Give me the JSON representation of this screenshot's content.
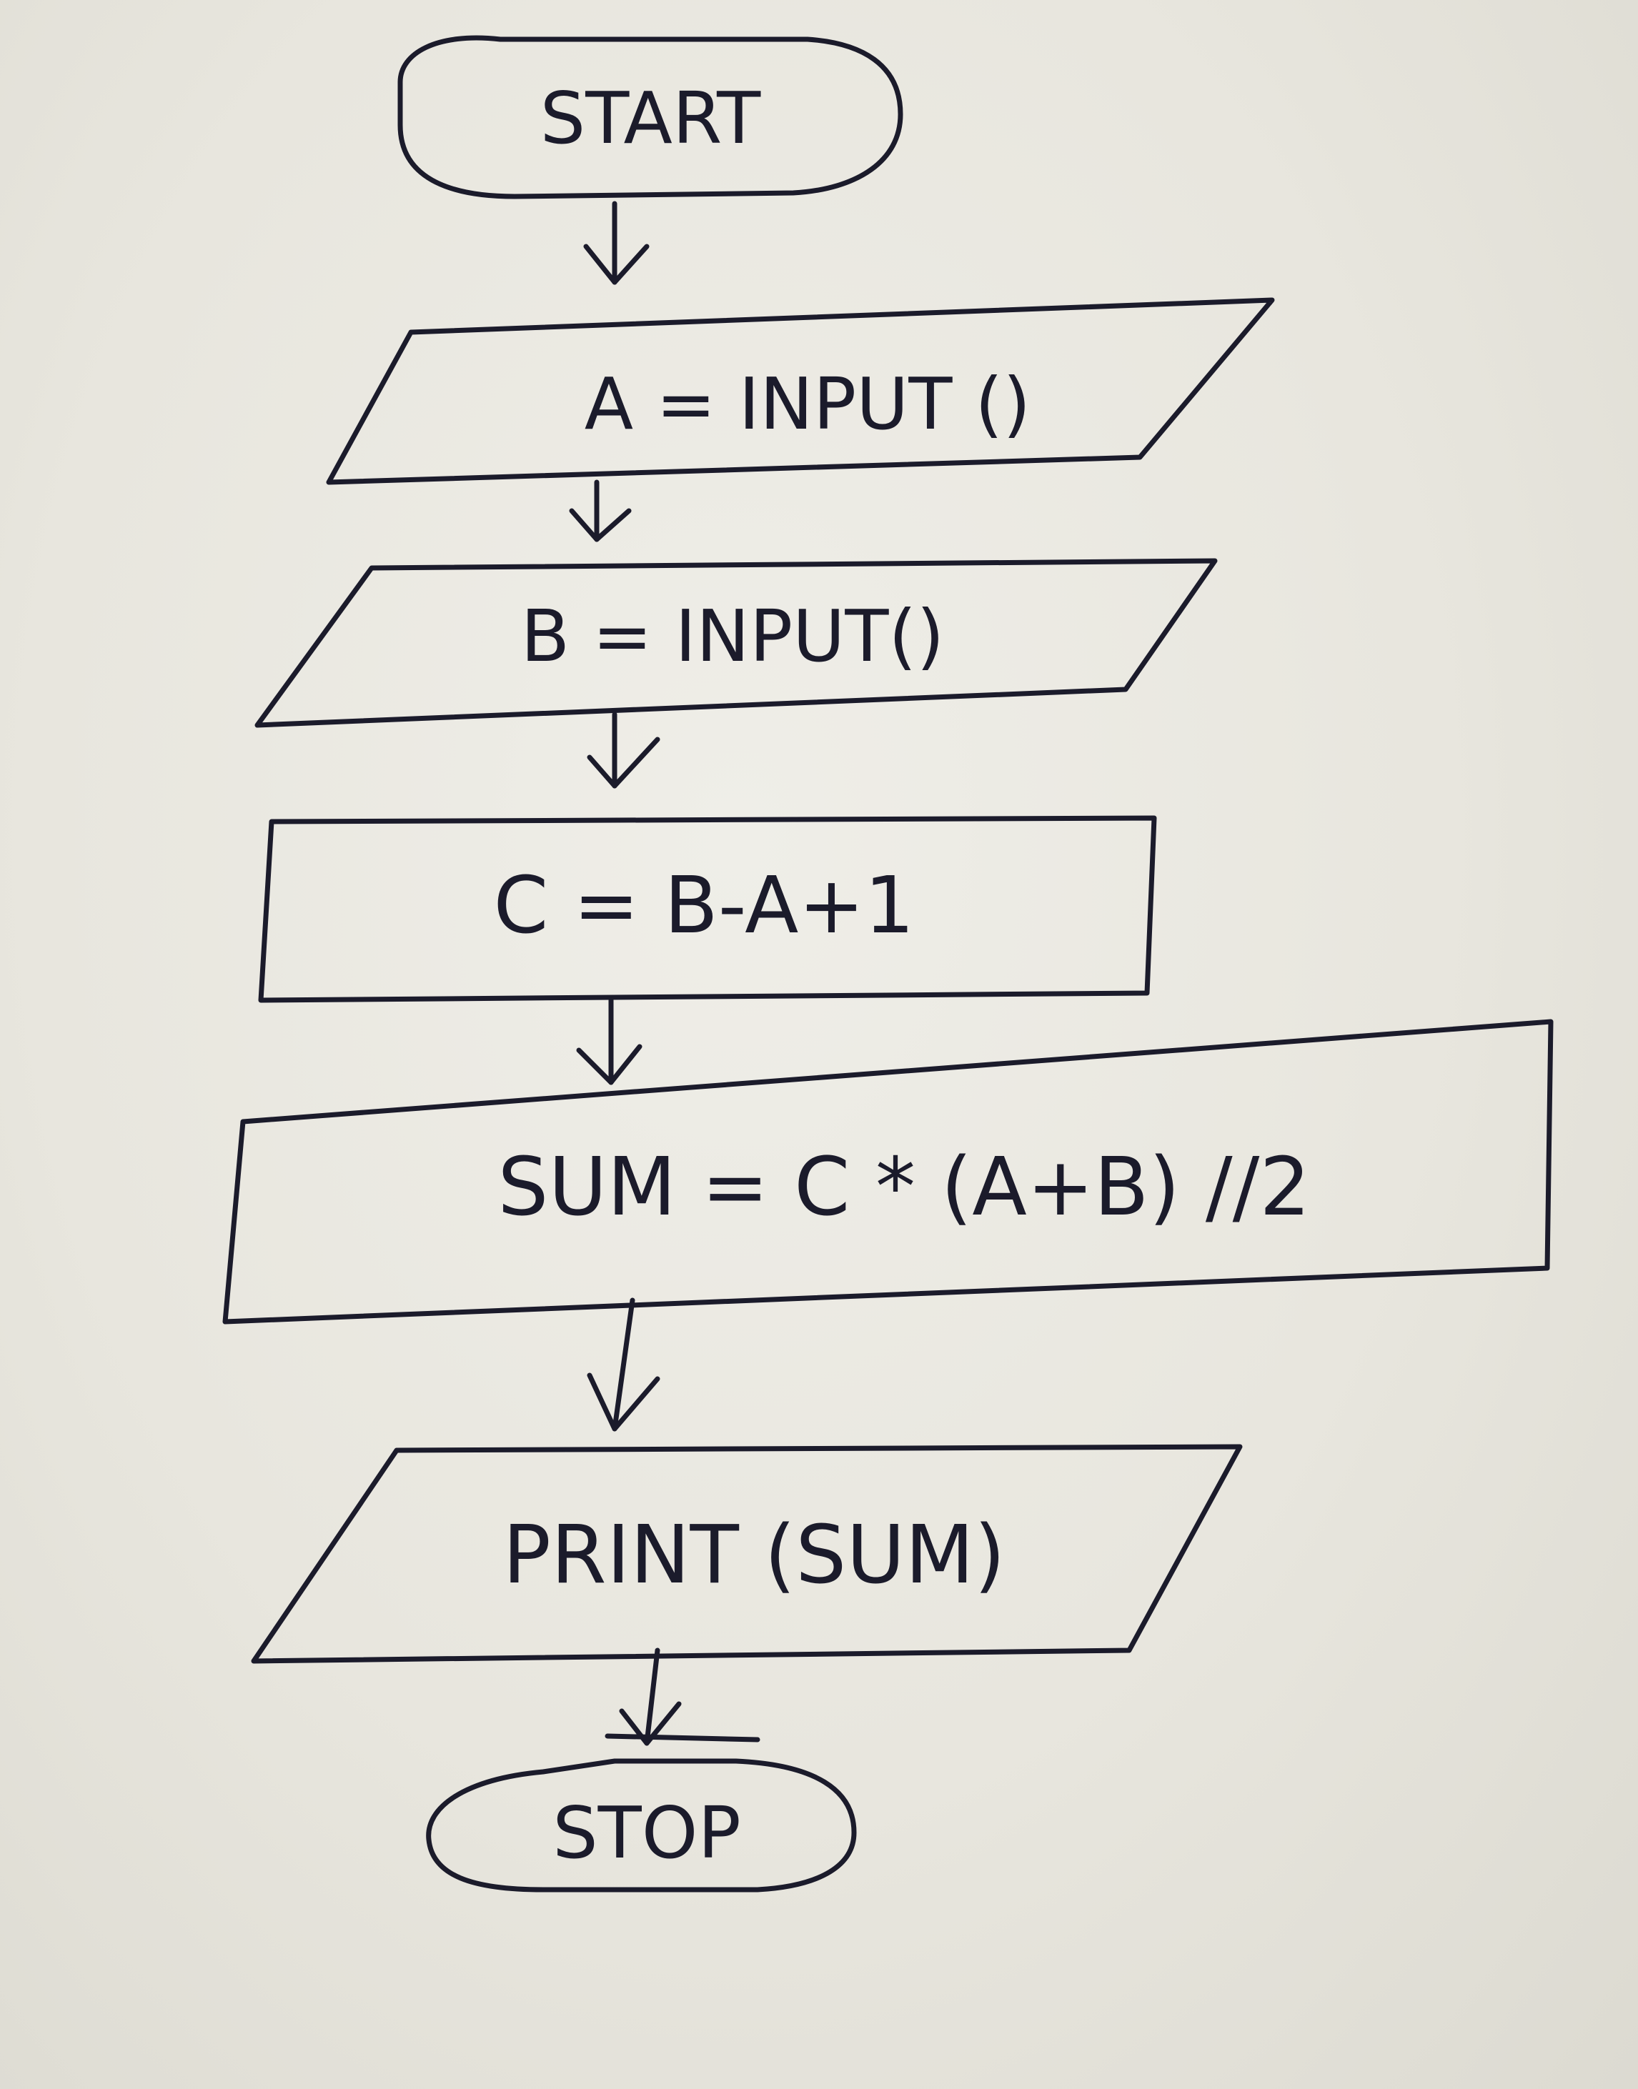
{
  "diagram": {
    "type": "flowchart",
    "ink_color": "#1b1b2b",
    "paper_color": "#e7e5dd",
    "nodes": [
      {
        "id": "start",
        "shape": "terminal",
        "label": "START"
      },
      {
        "id": "input-a",
        "shape": "input-output",
        "label": "A = INPUT ()"
      },
      {
        "id": "input-b",
        "shape": "input-output",
        "label": "B = INPUT()"
      },
      {
        "id": "calc-c",
        "shape": "process",
        "label": "C = B-A+1"
      },
      {
        "id": "calc-sum",
        "shape": "process",
        "label": "SUM = C * (A+B) //2"
      },
      {
        "id": "print-sum",
        "shape": "input-output",
        "label": "PRINT (SUM)"
      },
      {
        "id": "stop",
        "shape": "terminal",
        "label": "STOP"
      }
    ],
    "edges": [
      {
        "from": "start",
        "to": "input-a"
      },
      {
        "from": "input-a",
        "to": "input-b"
      },
      {
        "from": "input-b",
        "to": "calc-c"
      },
      {
        "from": "calc-c",
        "to": "calc-sum"
      },
      {
        "from": "calc-sum",
        "to": "print-sum"
      },
      {
        "from": "print-sum",
        "to": "stop"
      }
    ]
  }
}
